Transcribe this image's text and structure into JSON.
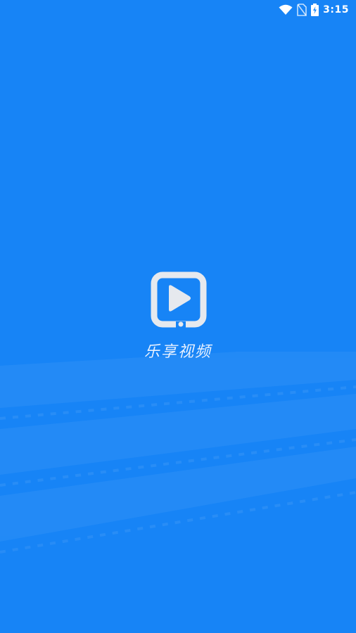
{
  "status_bar": {
    "time": "3:15",
    "icons": [
      "wifi-icon",
      "no-sim-icon",
      "battery-charging-icon"
    ]
  },
  "splash": {
    "logo_icon": "play-video-icon",
    "app_name": "乐享视频"
  },
  "colors": {
    "background": "#1784f6",
    "logo": "#e6e9ee",
    "text": "#e8f1ff"
  }
}
